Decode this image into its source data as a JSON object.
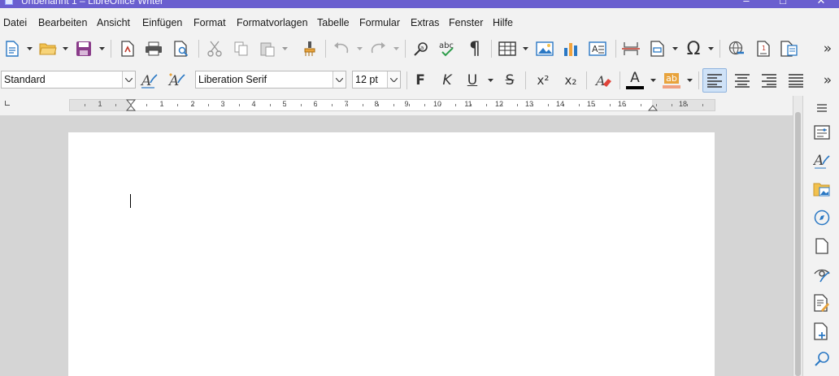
{
  "window": {
    "title": "Unbenannt 1 – LibreOffice Writer"
  },
  "menubar": {
    "items": [
      "Datei",
      "Bearbeiten",
      "Ansicht",
      "Einfügen",
      "Format",
      "Formatvorlagen",
      "Tabelle",
      "Formular",
      "Extras",
      "Fenster",
      "Hilfe"
    ]
  },
  "formatting": {
    "paragraph_style": "Standard",
    "font_name": "Liberation Serif",
    "font_size": "12 pt",
    "bold_glyph": "F",
    "italic_glyph": "K",
    "underline_glyph": "U",
    "strike_glyph": "S",
    "superscript_glyph": "x²",
    "subscript_glyph": "x₂",
    "font_color_glyph": "A",
    "highlight_glyph": "ab"
  },
  "ruler": {
    "labels": [
      "1",
      "1",
      "2",
      "3",
      "4",
      "5",
      "6",
      "7",
      "8",
      "9",
      "10",
      "11",
      "12",
      "13",
      "14",
      "15",
      "16",
      "18"
    ]
  },
  "colors": {
    "titlebar": "#6a5fcf",
    "accent_blue": "#2a78c4",
    "save_purple": "#8a3c8a",
    "font_color_bar": "#000000",
    "highlight_bar": "#f0a080",
    "active_align_bg": "#cfe2f7"
  },
  "icons": {
    "toolbar": [
      "new-document-icon",
      "open-folder-icon",
      "save-icon",
      "export-pdf-icon",
      "print-icon",
      "print-preview-icon",
      "cut-icon",
      "copy-icon",
      "paste-icon",
      "clone-formatting-icon",
      "undo-icon",
      "redo-icon",
      "find-replace-icon",
      "spellcheck-icon",
      "formatting-marks-icon",
      "insert-table-icon",
      "insert-image-icon",
      "insert-chart-icon",
      "insert-textbox-icon",
      "page-break-icon",
      "insert-field-icon",
      "special-character-icon",
      "hyperlink-icon",
      "footnote-icon",
      "comment-icon",
      "more-icon"
    ],
    "sidebar": [
      "sidebar-menu-icon",
      "properties-icon",
      "styles-icon",
      "gallery-icon",
      "navigator-icon",
      "page-icon",
      "style-inspector-icon",
      "manage-changes-icon",
      "design-icon",
      "find-icon"
    ]
  }
}
